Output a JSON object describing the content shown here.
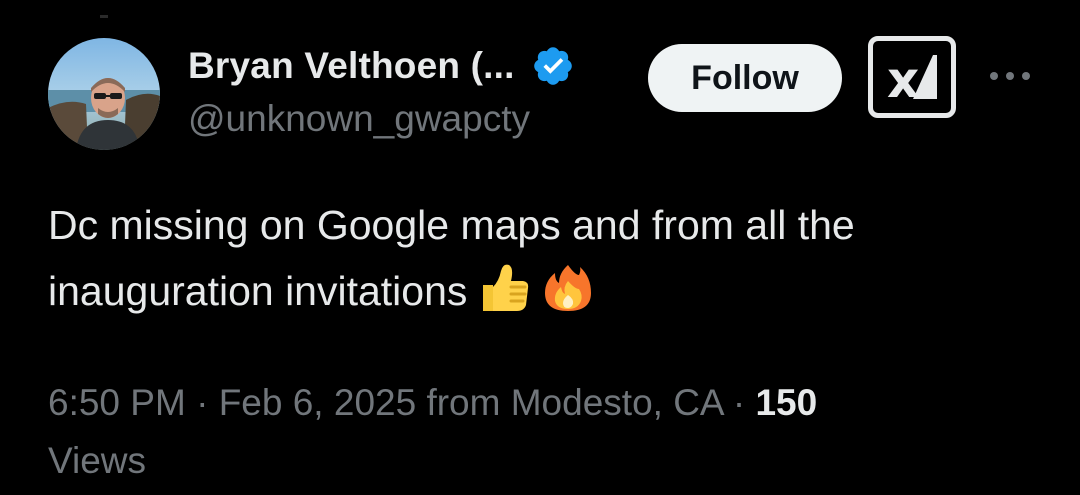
{
  "tweet": {
    "author": {
      "display_name": "Bryan Velthoen (...",
      "handle": "@unknown_gwapcty",
      "verified": true,
      "avatar_icon": "profile-photo"
    },
    "follow_label": "Follow",
    "grok_icon": "grok-icon",
    "more_icon": "more-horizontal-icon",
    "text_line1": "Dc missing on Google maps and from all the",
    "text_line2": "inauguration invitations",
    "emojis": [
      "thumbs-up",
      "fire"
    ],
    "time": "6:50 PM",
    "separator": " · ",
    "date": "Feb 6, 2025",
    "location": "from Modesto, CA",
    "views_count": "150",
    "views_label": "Views"
  },
  "colors": {
    "background": "#000000",
    "text_primary": "#e7e9ea",
    "text_secondary": "#71767b",
    "verified_blue": "#1d9bf0",
    "follow_bg": "#eff3f4"
  }
}
